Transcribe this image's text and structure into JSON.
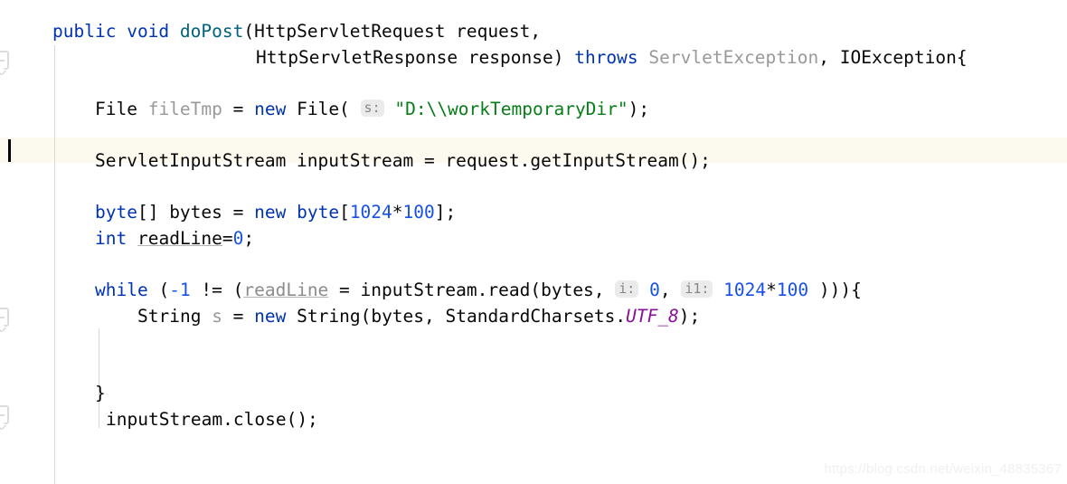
{
  "editor": {
    "kind": "java-code-editor",
    "language": "Java",
    "background_color": "#ffffff",
    "current_line_highlight_color": "#fcfaef",
    "caret_color": "#000000",
    "indent_guide_color": "#d8d8d8",
    "palette": {
      "text": "#080808",
      "keyword": "#0033b3",
      "number": "#1750eb",
      "string": "#067d17",
      "method_declaration": "#00627a",
      "dimmed_identifier": "#999999",
      "static_final_field": "#871094",
      "inlay_hint_background": "#ebebeb",
      "inlay_hint_text": "#868686",
      "watermark": "#f0f0f0"
    },
    "gutter": {
      "fold_markers": [
        "fold-marker-method",
        "fold-marker-while",
        "fold-marker-unknown"
      ]
    },
    "lines": [
      {
        "n": 1,
        "indent": 58,
        "tokens": [
          {
            "t": "public",
            "c": "kw"
          },
          {
            "t": " ",
            "c": ""
          },
          {
            "t": "void",
            "c": "kw"
          },
          {
            "t": " ",
            "c": ""
          },
          {
            "t": "doPost",
            "c": "method"
          },
          {
            "t": "(HttpServletRequest request,",
            "c": ""
          }
        ]
      },
      {
        "n": 2,
        "indent": 283,
        "tokens": [
          {
            "t": "HttpServletResponse response) ",
            "c": ""
          },
          {
            "t": "throws",
            "c": "kw"
          },
          {
            "t": " ",
            "c": ""
          },
          {
            "t": "ServletException",
            "c": "dim"
          },
          {
            "t": ", IOException{",
            "c": ""
          }
        ]
      },
      {
        "n": 3,
        "indent": 0,
        "tokens": []
      },
      {
        "n": 4,
        "indent": 105,
        "tokens": [
          {
            "t": "File ",
            "c": ""
          },
          {
            "t": "fileTmp",
            "c": "dim"
          },
          {
            "t": " = ",
            "c": ""
          },
          {
            "t": "new",
            "c": "kw"
          },
          {
            "t": " File( ",
            "c": ""
          },
          {
            "t": "s:",
            "c": "hint"
          },
          {
            "t": " ",
            "c": ""
          },
          {
            "t": "\"D:\\\\workTemporaryDir\"",
            "c": "str"
          },
          {
            "t": ");",
            "c": ""
          }
        ]
      },
      {
        "n": 5,
        "indent": 0,
        "tokens": [],
        "current": true
      },
      {
        "n": 6,
        "indent": 105,
        "tokens": [
          {
            "t": "ServletInputStream inputStream = request.getInputStream();",
            "c": ""
          }
        ]
      },
      {
        "n": 7,
        "indent": 0,
        "tokens": []
      },
      {
        "n": 8,
        "indent": 105,
        "tokens": [
          {
            "t": "byte",
            "c": "kw"
          },
          {
            "t": "[] bytes = ",
            "c": ""
          },
          {
            "t": "new",
            "c": "kw"
          },
          {
            "t": " ",
            "c": ""
          },
          {
            "t": "byte",
            "c": "kw"
          },
          {
            "t": "[",
            "c": ""
          },
          {
            "t": "1024",
            "c": "num"
          },
          {
            "t": "*",
            "c": ""
          },
          {
            "t": "100",
            "c": "num"
          },
          {
            "t": "];",
            "c": ""
          }
        ]
      },
      {
        "n": 9,
        "indent": 105,
        "tokens": [
          {
            "t": "int",
            "c": "kw"
          },
          {
            "t": " ",
            "c": ""
          },
          {
            "t": "readLine",
            "c": "reassign2"
          },
          {
            "t": "=",
            "c": ""
          },
          {
            "t": "0",
            "c": "num"
          },
          {
            "t": ";",
            "c": ""
          }
        ]
      },
      {
        "n": 10,
        "indent": 0,
        "tokens": []
      },
      {
        "n": 11,
        "indent": 105,
        "tokens": [
          {
            "t": "while",
            "c": "kw"
          },
          {
            "t": " (",
            "c": ""
          },
          {
            "t": "-1",
            "c": "num"
          },
          {
            "t": " != (",
            "c": ""
          },
          {
            "t": "readLine",
            "c": "reassign"
          },
          {
            "t": " = inputStream.read(bytes, ",
            "c": ""
          },
          {
            "t": "i:",
            "c": "hint"
          },
          {
            "t": " ",
            "c": ""
          },
          {
            "t": "0",
            "c": "num"
          },
          {
            "t": ", ",
            "c": ""
          },
          {
            "t": "i1:",
            "c": "hint"
          },
          {
            "t": " ",
            "c": ""
          },
          {
            "t": "1024",
            "c": "num"
          },
          {
            "t": "*",
            "c": ""
          },
          {
            "t": "100",
            "c": "num"
          },
          {
            "t": " ))){",
            "c": ""
          }
        ]
      },
      {
        "n": 12,
        "indent": 152,
        "tokens": [
          {
            "t": "String ",
            "c": ""
          },
          {
            "t": "s",
            "c": "dim"
          },
          {
            "t": " = ",
            "c": ""
          },
          {
            "t": "new",
            "c": "kw"
          },
          {
            "t": " String(bytes, StandardCharsets.",
            "c": ""
          },
          {
            "t": "UTF_8",
            "c": "static-f"
          },
          {
            "t": ");",
            "c": ""
          }
        ]
      },
      {
        "n": 13,
        "indent": 0,
        "tokens": []
      },
      {
        "n": 14,
        "indent": 0,
        "tokens": []
      },
      {
        "n": 15,
        "indent": 105,
        "tokens": [
          {
            "t": "}",
            "c": ""
          }
        ]
      },
      {
        "n": 16,
        "indent": 117,
        "tokens": [
          {
            "t": "inputStream.close();",
            "c": ""
          }
        ]
      }
    ]
  },
  "watermark": {
    "text": "https://blog.csdn.net/weixin_48835367"
  }
}
